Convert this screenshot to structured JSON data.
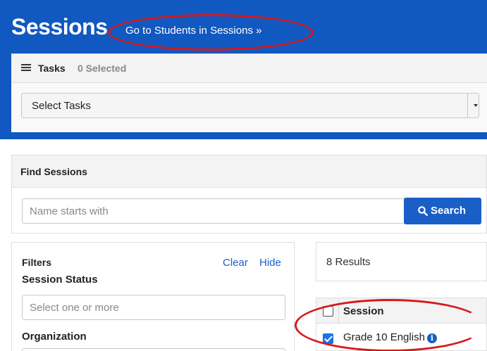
{
  "header": {
    "title": "Sessions",
    "go_link": "Go to Students in Sessions »"
  },
  "tasks": {
    "label": "Tasks",
    "count": "0 Selected",
    "select_label": "Select Tasks"
  },
  "find_sessions": {
    "title": "Find Sessions",
    "name_placeholder": "Name starts with",
    "search_label": "Search"
  },
  "filters": {
    "title": "Filters",
    "clear_label": "Clear",
    "hide_label": "Hide",
    "session_status_label": "Session Status",
    "session_status_placeholder": "Select one or more",
    "organization_label": "Organization"
  },
  "results": {
    "count_text": "8 Results"
  },
  "table": {
    "column_header": "Session",
    "header_checked": false,
    "rows": [
      {
        "name": "Grade 10 English",
        "checked": true,
        "info_icon": "i"
      }
    ]
  },
  "annotations": {
    "color": "#d81818",
    "targets": [
      "go-to-students-link",
      "session-row-grade-10-english"
    ]
  },
  "colors": {
    "header_bg": "#1158c0",
    "primary_button": "#1a5fc8",
    "checkbox_checked": "#1a73e8"
  }
}
